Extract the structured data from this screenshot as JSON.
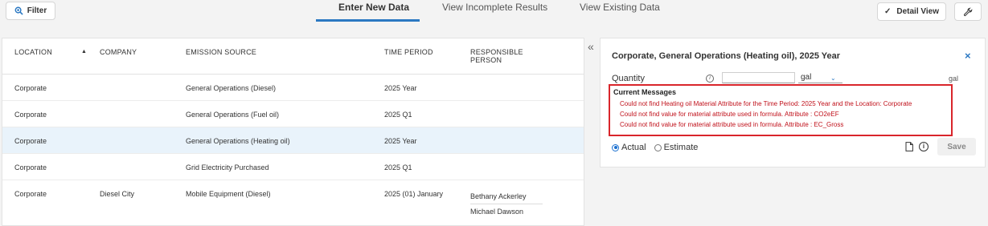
{
  "toolbar": {
    "filter_label": "Filter",
    "detail_view_label": "Detail View"
  },
  "tabs": [
    {
      "label": "Enter New Data",
      "active": true
    },
    {
      "label": "View Incomplete Results",
      "active": false
    },
    {
      "label": "View Existing Data",
      "active": false
    }
  ],
  "table": {
    "columns": [
      "LOCATION",
      "COMPANY",
      "EMISSION SOURCE",
      "TIME PERIOD",
      "RESPONSIBLE",
      "PERSON"
    ],
    "rows": [
      {
        "location": "Corporate",
        "company": "",
        "source": "General Operations (Diesel)",
        "period": "2025 Year",
        "person1": "",
        "person2": ""
      },
      {
        "location": "Corporate",
        "company": "",
        "source": "General Operations (Fuel oil)",
        "period": "2025 Q1",
        "person1": "",
        "person2": ""
      },
      {
        "location": "Corporate",
        "company": "",
        "source": "General Operations (Heating oil)",
        "period": "2025 Year",
        "person1": "",
        "person2": ""
      },
      {
        "location": "Corporate",
        "company": "",
        "source": "Grid Electricity Purchased",
        "period": "2025 Q1",
        "person1": "",
        "person2": ""
      },
      {
        "location": "Corporate",
        "company": "Diesel City",
        "source": "Mobile Equipment (Diesel)",
        "period": "2025 (01) January",
        "person1": "Bethany Ackerley",
        "person2": "Michael Dawson"
      }
    ]
  },
  "detail": {
    "title": "Corporate, General Operations (Heating oil), 2025 Year",
    "close": "×",
    "quantity_label": "Quantity",
    "quantity_value": "",
    "unit": "gal",
    "unit_right": "gal",
    "messages_heading": "Current Messages",
    "messages": [
      "Could not find Heating oil Material Attribute for the Time Period: 2025 Year and the Location: Corporate",
      "Could not find value for material attribute used in formula. Attribute : CO2eEF",
      "Could not find value for material attribute used in formula. Attribute : EC_Gross"
    ],
    "actual_label": "Actual",
    "estimate_label": "Estimate",
    "save_label": "Save"
  },
  "colors": {
    "accent": "#2b78c2",
    "error": "#c0101a",
    "error_border": "#d9252b",
    "selected_row": "#e9f3fb"
  }
}
